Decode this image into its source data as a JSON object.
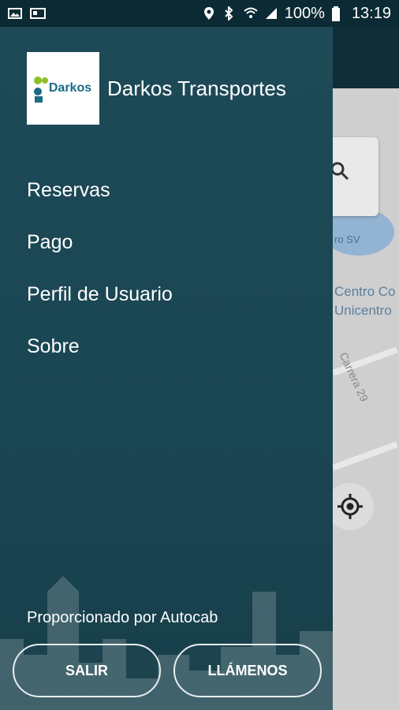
{
  "status_bar": {
    "battery": "100%",
    "time": "13:19"
  },
  "drawer": {
    "app_title": "Darkos Transportes",
    "logo_text": "Darkos",
    "menu": [
      {
        "label": "Reservas"
      },
      {
        "label": "Pago"
      },
      {
        "label": "Perfil de Usuario"
      },
      {
        "label": "Sobre"
      }
    ],
    "powered_by": "Proporcionado por Autocab",
    "buttons": {
      "exit": "SALIR",
      "call": "LLÁMENOS"
    }
  },
  "map": {
    "place_label_line1": "Centro Co",
    "place_label_line2": "Unicentro",
    "street_label": "Carrera 29",
    "water_label": "ro SV"
  },
  "colors": {
    "drawer_bg": "#1e4a57",
    "status_bar_bg": "#0b2a33",
    "text": "#ffffff"
  }
}
